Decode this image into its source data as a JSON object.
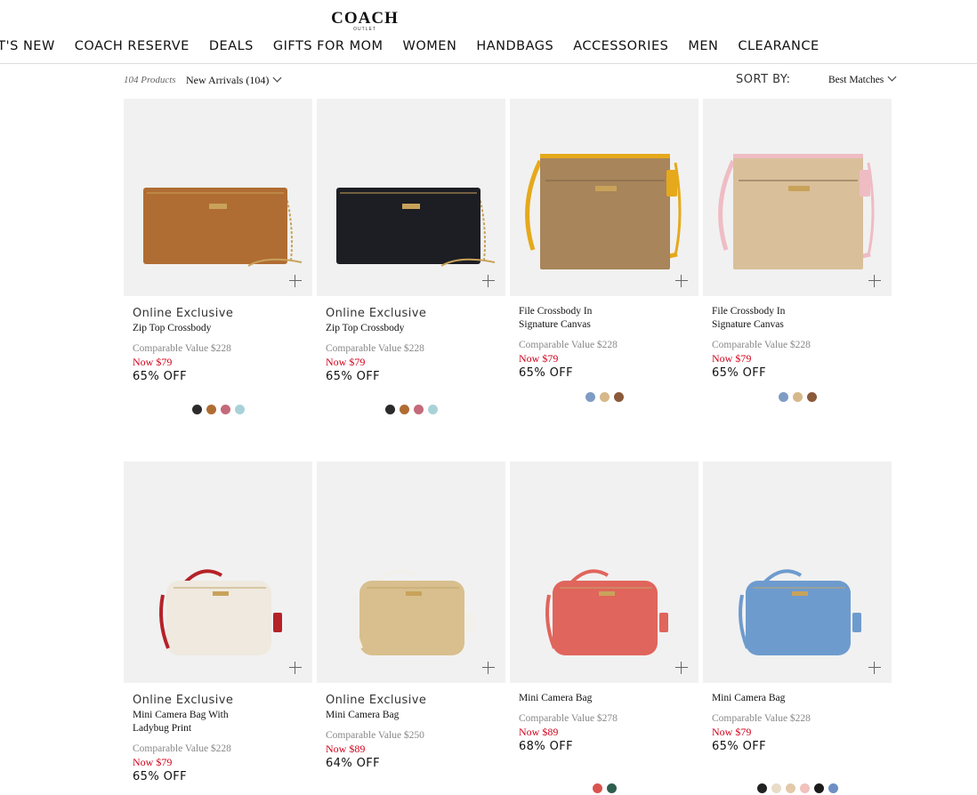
{
  "brand": {
    "name": "COACH",
    "sub": "OUTLET"
  },
  "nav": [
    "AT'S NEW",
    "COACH RESERVE",
    "DEALS",
    "GIFTS FOR MOM",
    "WOMEN",
    "HANDBAGS",
    "ACCESSORIES",
    "MEN",
    "CLEARANCE"
  ],
  "toolbar": {
    "count": "104 Products",
    "filter": "New Arrivals (104)",
    "sort_label": "SORT BY:",
    "sort_value": "Best Matches"
  },
  "products": [
    {
      "tag": "Online Exclusive",
      "name": "Zip Top Crossbody",
      "comp": "Comparable Value $228",
      "now": "Now $79",
      "off": "65% OFF",
      "bag": "wristlet",
      "color": "#b06d33",
      "strap": "#c9a25a",
      "swatches": [
        "#2b2b2b",
        "#b06d33",
        "#c46a7a",
        "#a9d2d8"
      ]
    },
    {
      "tag": "Online Exclusive",
      "name": "Zip Top Crossbody",
      "comp": "Comparable Value $228",
      "now": "Now $79",
      "off": "65% OFF",
      "bag": "wristlet",
      "color": "#1d1e24",
      "strap": "#c9a25a",
      "swatches": [
        "#2b2b2b",
        "#b06d33",
        "#c46a7a",
        "#a9d2d8"
      ]
    },
    {
      "tag": "",
      "name": "File Crossbody In\nSignature Canvas",
      "comp": "Comparable Value $228",
      "now": "Now $79",
      "off": "65% OFF",
      "bag": "file",
      "color": "#a8855a",
      "strap": "#e6a91c",
      "swatches": [
        "#7e9cc4",
        "#d6b88a",
        "#8b5a3a"
      ]
    },
    {
      "tag": "",
      "name": "File Crossbody In\nSignature Canvas",
      "comp": "Comparable Value $228",
      "now": "Now $79",
      "off": "65% OFF",
      "bag": "file",
      "color": "#d9c09a",
      "strap": "#efbcc4",
      "swatches": [
        "#7e9cc4",
        "#d6b88a",
        "#8b5a3a"
      ]
    },
    {
      "tag": "Online Exclusive",
      "name": "Mini Camera Bag With\nLadybug Print",
      "comp": "Comparable Value $228",
      "now": "Now $79",
      "off": "65% OFF",
      "bag": "camera",
      "color": "#efe9df",
      "strap": "#b52228",
      "swatches": []
    },
    {
      "tag": "Online Exclusive",
      "name": "Mini Camera Bag",
      "comp": "Comparable Value $250",
      "now": "Now $89",
      "off": "64% OFF",
      "bag": "camera",
      "color": "#d8bf8d",
      "strap": "#f2f0ea",
      "swatches": []
    },
    {
      "tag": "",
      "name": "Mini Camera Bag",
      "comp": "Comparable Value $278",
      "now": "Now $89",
      "off": "68% OFF",
      "bag": "camera",
      "color": "#e0655c",
      "strap": "#e0655c",
      "swatches": [
        "#d9534f",
        "#2e5e4e"
      ]
    },
    {
      "tag": "",
      "name": "Mini Camera Bag",
      "comp": "Comparable Value $228",
      "now": "Now $79",
      "off": "65% OFF",
      "bag": "camera",
      "color": "#6e9bce",
      "strap": "#6e9bce",
      "swatches": [
        "#222222",
        "#e8dcc7",
        "#e3c9a8",
        "#f0c1bd",
        "#1b1b1b",
        "#6e8fc5"
      ]
    }
  ]
}
